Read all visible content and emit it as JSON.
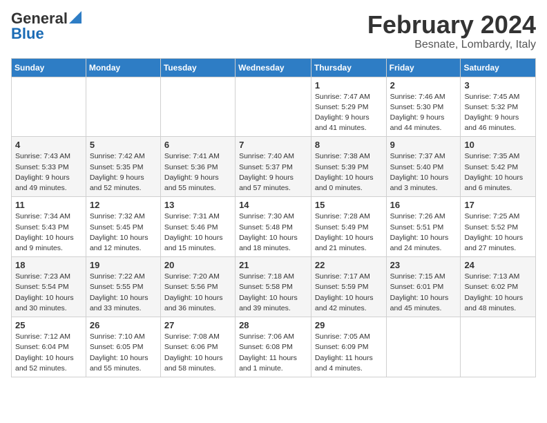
{
  "logo": {
    "general": "General",
    "blue": "Blue"
  },
  "title": "February 2024",
  "subtitle": "Besnate, Lombardy, Italy",
  "days_header": [
    "Sunday",
    "Monday",
    "Tuesday",
    "Wednesday",
    "Thursday",
    "Friday",
    "Saturday"
  ],
  "weeks": [
    [
      {
        "day": "",
        "info": ""
      },
      {
        "day": "",
        "info": ""
      },
      {
        "day": "",
        "info": ""
      },
      {
        "day": "",
        "info": ""
      },
      {
        "day": "1",
        "info": "Sunrise: 7:47 AM\nSunset: 5:29 PM\nDaylight: 9 hours\nand 41 minutes."
      },
      {
        "day": "2",
        "info": "Sunrise: 7:46 AM\nSunset: 5:30 PM\nDaylight: 9 hours\nand 44 minutes."
      },
      {
        "day": "3",
        "info": "Sunrise: 7:45 AM\nSunset: 5:32 PM\nDaylight: 9 hours\nand 46 minutes."
      }
    ],
    [
      {
        "day": "4",
        "info": "Sunrise: 7:43 AM\nSunset: 5:33 PM\nDaylight: 9 hours\nand 49 minutes."
      },
      {
        "day": "5",
        "info": "Sunrise: 7:42 AM\nSunset: 5:35 PM\nDaylight: 9 hours\nand 52 minutes."
      },
      {
        "day": "6",
        "info": "Sunrise: 7:41 AM\nSunset: 5:36 PM\nDaylight: 9 hours\nand 55 minutes."
      },
      {
        "day": "7",
        "info": "Sunrise: 7:40 AM\nSunset: 5:37 PM\nDaylight: 9 hours\nand 57 minutes."
      },
      {
        "day": "8",
        "info": "Sunrise: 7:38 AM\nSunset: 5:39 PM\nDaylight: 10 hours\nand 0 minutes."
      },
      {
        "day": "9",
        "info": "Sunrise: 7:37 AM\nSunset: 5:40 PM\nDaylight: 10 hours\nand 3 minutes."
      },
      {
        "day": "10",
        "info": "Sunrise: 7:35 AM\nSunset: 5:42 PM\nDaylight: 10 hours\nand 6 minutes."
      }
    ],
    [
      {
        "day": "11",
        "info": "Sunrise: 7:34 AM\nSunset: 5:43 PM\nDaylight: 10 hours\nand 9 minutes."
      },
      {
        "day": "12",
        "info": "Sunrise: 7:32 AM\nSunset: 5:45 PM\nDaylight: 10 hours\nand 12 minutes."
      },
      {
        "day": "13",
        "info": "Sunrise: 7:31 AM\nSunset: 5:46 PM\nDaylight: 10 hours\nand 15 minutes."
      },
      {
        "day": "14",
        "info": "Sunrise: 7:30 AM\nSunset: 5:48 PM\nDaylight: 10 hours\nand 18 minutes."
      },
      {
        "day": "15",
        "info": "Sunrise: 7:28 AM\nSunset: 5:49 PM\nDaylight: 10 hours\nand 21 minutes."
      },
      {
        "day": "16",
        "info": "Sunrise: 7:26 AM\nSunset: 5:51 PM\nDaylight: 10 hours\nand 24 minutes."
      },
      {
        "day": "17",
        "info": "Sunrise: 7:25 AM\nSunset: 5:52 PM\nDaylight: 10 hours\nand 27 minutes."
      }
    ],
    [
      {
        "day": "18",
        "info": "Sunrise: 7:23 AM\nSunset: 5:54 PM\nDaylight: 10 hours\nand 30 minutes."
      },
      {
        "day": "19",
        "info": "Sunrise: 7:22 AM\nSunset: 5:55 PM\nDaylight: 10 hours\nand 33 minutes."
      },
      {
        "day": "20",
        "info": "Sunrise: 7:20 AM\nSunset: 5:56 PM\nDaylight: 10 hours\nand 36 minutes."
      },
      {
        "day": "21",
        "info": "Sunrise: 7:18 AM\nSunset: 5:58 PM\nDaylight: 10 hours\nand 39 minutes."
      },
      {
        "day": "22",
        "info": "Sunrise: 7:17 AM\nSunset: 5:59 PM\nDaylight: 10 hours\nand 42 minutes."
      },
      {
        "day": "23",
        "info": "Sunrise: 7:15 AM\nSunset: 6:01 PM\nDaylight: 10 hours\nand 45 minutes."
      },
      {
        "day": "24",
        "info": "Sunrise: 7:13 AM\nSunset: 6:02 PM\nDaylight: 10 hours\nand 48 minutes."
      }
    ],
    [
      {
        "day": "25",
        "info": "Sunrise: 7:12 AM\nSunset: 6:04 PM\nDaylight: 10 hours\nand 52 minutes."
      },
      {
        "day": "26",
        "info": "Sunrise: 7:10 AM\nSunset: 6:05 PM\nDaylight: 10 hours\nand 55 minutes."
      },
      {
        "day": "27",
        "info": "Sunrise: 7:08 AM\nSunset: 6:06 PM\nDaylight: 10 hours\nand 58 minutes."
      },
      {
        "day": "28",
        "info": "Sunrise: 7:06 AM\nSunset: 6:08 PM\nDaylight: 11 hours\nand 1 minute."
      },
      {
        "day": "29",
        "info": "Sunrise: 7:05 AM\nSunset: 6:09 PM\nDaylight: 11 hours\nand 4 minutes."
      },
      {
        "day": "",
        "info": ""
      },
      {
        "day": "",
        "info": ""
      }
    ]
  ]
}
